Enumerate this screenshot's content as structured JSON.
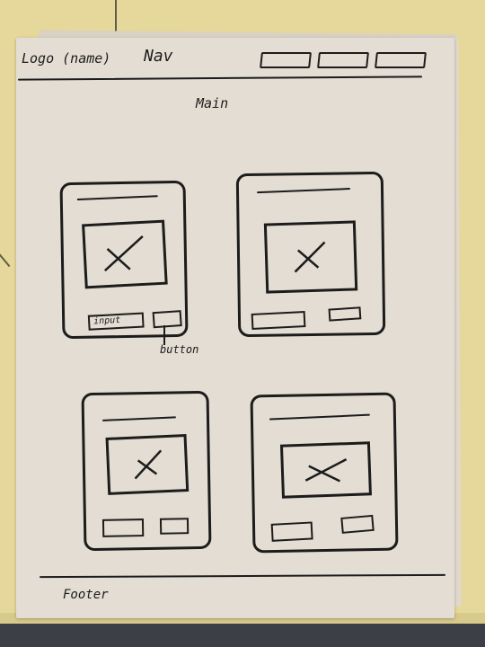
{
  "header": {
    "logo_text": "Logo (name)",
    "nav_text": "Nav",
    "nav_buttons": [
      "",
      "",
      ""
    ]
  },
  "main": {
    "label": "Main",
    "cards": [
      {
        "image_icon": "x-placeholder-icon",
        "has_input": true,
        "input_label": "input",
        "button_annotation": "button"
      },
      {
        "image_icon": "x-placeholder-icon"
      },
      {
        "image_icon": "x-placeholder-icon"
      },
      {
        "image_icon": "x-placeholder-icon"
      }
    ]
  },
  "footer": {
    "label": "Footer"
  },
  "colors": {
    "ink": "#1c1c1c",
    "paper": "#e3ddd3",
    "floor": "#e6d79a"
  }
}
